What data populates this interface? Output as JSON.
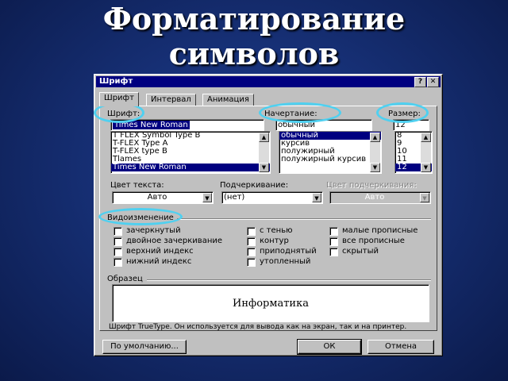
{
  "slide": {
    "title_line1": "Форматирование",
    "title_line2": "символов"
  },
  "dialog": {
    "title": "Шрифт",
    "help_btn": "?",
    "close_btn": "✕",
    "tabs": [
      "Шрифт",
      "Интервал",
      "Анимация"
    ],
    "font": {
      "label": "Шрифт:",
      "value": "Times New Roman",
      "items": [
        "T FLEX Symbol Type B",
        "T-FLEX Type A",
        "T-FLEX type B",
        "Tlames",
        "Times New Roman"
      ],
      "selected": "Times New Roman"
    },
    "style": {
      "label": "Начертание:",
      "value": "обычный",
      "items": [
        "обычный",
        "курсив",
        "полужирный",
        "полужирный курсив"
      ],
      "selected": "обычный"
    },
    "size": {
      "label": "Размер:",
      "value": "12",
      "items": [
        "8",
        "9",
        "10",
        "11",
        "12"
      ],
      "selected": "12"
    },
    "text_color": {
      "label": "Цвет текста:",
      "value": "Авто"
    },
    "underline": {
      "label": "Подчеркивание:",
      "value": "(нет)"
    },
    "underline_color": {
      "label": "Цвет подчеркивания:",
      "value": "Авто"
    },
    "effects": {
      "label": "Видоизменение",
      "col1": [
        "зачеркнутый",
        "двойное зачеркивание",
        "верхний индекс",
        "нижний индекс"
      ],
      "col2": [
        "с тенью",
        "контур",
        "приподнятый",
        "утопленный"
      ],
      "col3": [
        "малые прописные",
        "все прописные",
        "скрытый"
      ]
    },
    "sample": {
      "label": "Образец",
      "text": "Информатика"
    },
    "info": "Шрифт TrueType. Он используется для вывода как на экран, так и на принтер.",
    "buttons": {
      "default": "По умолчанию...",
      "ok": "ОК",
      "cancel": "Отмена"
    }
  },
  "colors": {
    "highlight_ellipse": "#4fd0f0",
    "selection": "#000080",
    "title_bar": "#000080"
  }
}
